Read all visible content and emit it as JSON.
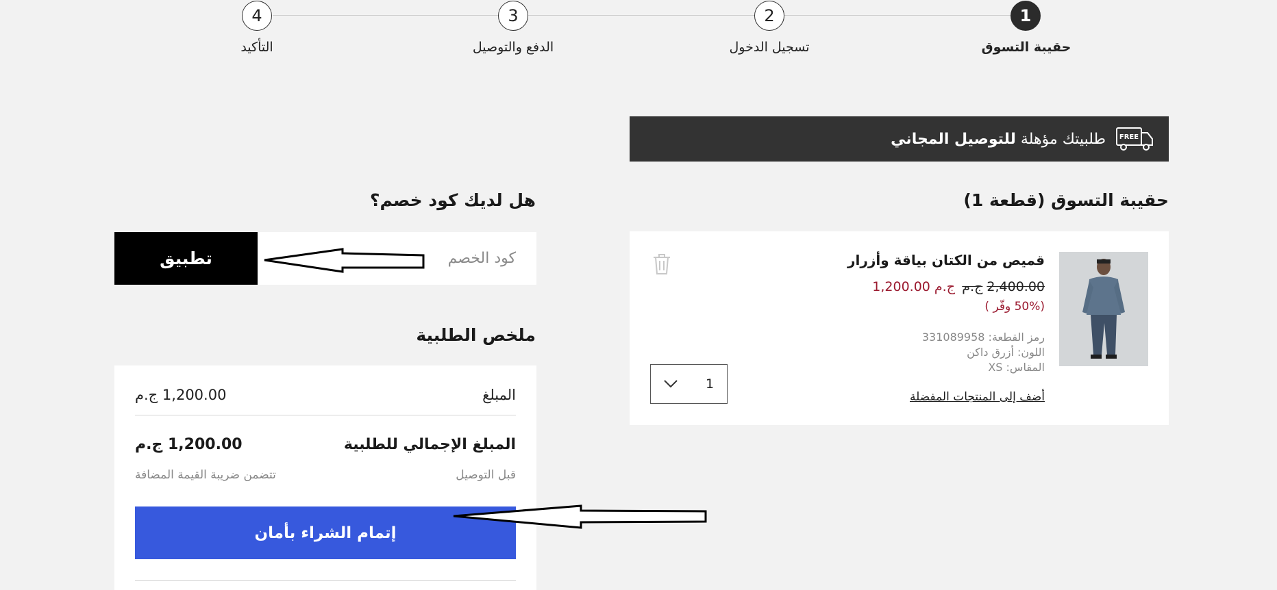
{
  "stepper": {
    "steps": [
      {
        "number": "1",
        "label": "حقيبة التسوق",
        "active": true
      },
      {
        "number": "2",
        "label": "تسجيل الدخول",
        "active": false
      },
      {
        "number": "3",
        "label": "الدفع والتوصيل",
        "active": false
      },
      {
        "number": "4",
        "label": "التأكيد",
        "active": false
      }
    ]
  },
  "banner": {
    "icon": "free-delivery-truck-icon",
    "icon_text": "FREE",
    "text_regular": "طلبيتك مؤهلة",
    "text_bold": "للتوصيل المجاني"
  },
  "cart": {
    "title": "حقيبة التسوق (قطعة 1)",
    "item": {
      "name": "قميص من الكتان بياقة وأزرار",
      "old_price": "2,400.00",
      "old_currency": "ج.م",
      "new_price": "1,200.00",
      "new_currency": "ج.م",
      "discount": "(50% وفّر )",
      "sku": "رمز القطعة: 331089958",
      "color": "اللون: أزرق داكن",
      "size": "المقاس: XS",
      "wishlist_link": "أضف إلى المنتجات المفضلة",
      "quantity": "1",
      "delete_icon": "trash-icon",
      "dropdown_icon": "chevron-down-icon"
    }
  },
  "coupon": {
    "title": "هل لديك كود خصم؟",
    "placeholder": "كود الخصم",
    "apply_label": "تطبيق"
  },
  "summary": {
    "title": "ملخص الطلبية",
    "subtotal_label": "المبلغ",
    "subtotal_value": "1,200.00 ج.م",
    "total_label": "المبلغ الإجمالي للطلبية",
    "total_value": "1,200.00 ج.م",
    "before_delivery": "قبل التوصيل",
    "vat_note": "تتضمن ضريبة القيمة المضافة",
    "checkout_label": "إتمام الشراء بأمان"
  },
  "colors": {
    "banner_bg": "#333333",
    "sale_price": "#9b1b30",
    "checkout_blue": "#3759dd",
    "apply_black": "#000000"
  }
}
